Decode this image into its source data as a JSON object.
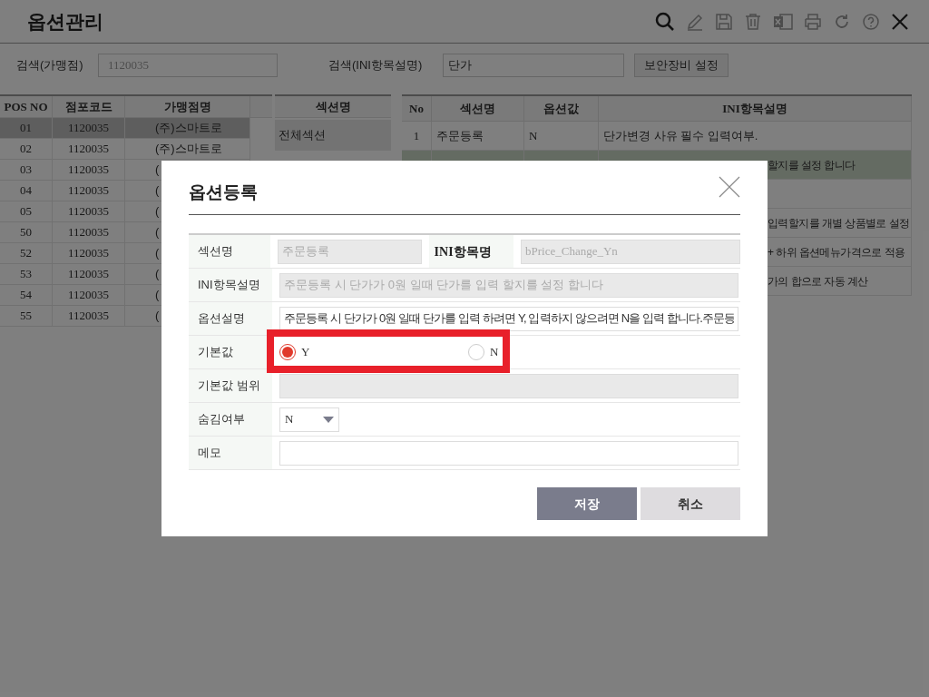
{
  "window": {
    "title": "옵션관리"
  },
  "search": [
    {
      "label": "검색(가맹점)",
      "value": "1120035",
      "disabled": true
    },
    {
      "label": "검색(INI항목설명)",
      "value": "단가",
      "disabled": false
    }
  ],
  "security_button": "보안장비 설정",
  "store_table": {
    "columns": [
      "POS NO",
      "점포코드",
      "가맹점명"
    ],
    "rows": [
      {
        "cells": [
          "01",
          "1120035",
          "(주)스마트로"
        ],
        "selected": true
      },
      {
        "cells": [
          "02",
          "1120035",
          "(주)스마트로"
        ],
        "selected": false
      },
      {
        "cells": [
          "03",
          "1120035",
          "("
        ],
        "selected": false
      },
      {
        "cells": [
          "04",
          "1120035",
          "("
        ],
        "selected": false
      },
      {
        "cells": [
          "05",
          "1120035",
          "("
        ],
        "selected": false
      },
      {
        "cells": [
          "50",
          "1120035",
          "("
        ],
        "selected": false
      },
      {
        "cells": [
          "52",
          "1120035",
          "("
        ],
        "selected": false
      },
      {
        "cells": [
          "53",
          "1120035",
          "("
        ],
        "selected": false
      },
      {
        "cells": [
          "54",
          "1120035",
          "("
        ],
        "selected": false
      },
      {
        "cells": [
          "55",
          "1120035",
          "("
        ],
        "selected": false
      }
    ]
  },
  "section_list": {
    "column": "섹션명",
    "items": [
      {
        "label": "전체섹션",
        "selected": true
      }
    ]
  },
  "option_table": {
    "columns": [
      "No",
      "섹션명",
      "옵션값",
      "INI항목설명"
    ],
    "rows": [
      {
        "cells": [
          "1",
          "주문등록",
          "N",
          "단가변경 사유 필수 입력여부."
        ],
        "selected": false
      },
      {
        "cells": [
          "",
          "",
          "",
          "할지를 설정 합니다"
        ],
        "selected": true
      },
      {
        "cells": [
          "",
          "",
          "",
          ""
        ],
        "selected": false
      },
      {
        "cells": [
          "",
          "",
          "",
          "입력할지를 개별 상품별로 설정"
        ],
        "selected": false
      },
      {
        "cells": [
          "",
          "",
          "",
          "+ 하위 옵션메뉴가격으로 적용"
        ],
        "selected": false
      },
      {
        "cells": [
          "",
          "",
          "",
          "가의 합으로 자동 계산"
        ],
        "selected": false
      }
    ]
  },
  "dialog": {
    "title": "옵션등록",
    "section_name": {
      "label": "섹션명",
      "value": "주문등록",
      "disabled": true
    },
    "ini_name": {
      "label": "INI항목명",
      "value": "bPrice_Change_Yn",
      "disabled": true
    },
    "ini_description": {
      "label": "INI항목설명",
      "value": "주문등록 시 단가가 0원 일때 단가를 입력 할지를 설정 합니다",
      "disabled": true
    },
    "option_description": {
      "label": "옵션설명",
      "value": "주문등록 시 단가가 0원 일때 단가를 입력 하려면 Y, 입력하지 않으려면 N을 입력 합니다.주문등",
      "disabled": false
    },
    "default_value": {
      "label": "기본값",
      "options": [
        {
          "label": "Y",
          "selected": true
        },
        {
          "label": "N",
          "selected": false
        }
      ]
    },
    "default_range": {
      "label": "기본값 범위",
      "disabled": true
    },
    "hidden": {
      "label": "숨김여부",
      "value": "N"
    },
    "memo": {
      "label": "메모"
    },
    "buttons": [
      {
        "label": "저장",
        "kind": "primary"
      },
      {
        "label": "취소",
        "kind": "secondary"
      }
    ]
  }
}
